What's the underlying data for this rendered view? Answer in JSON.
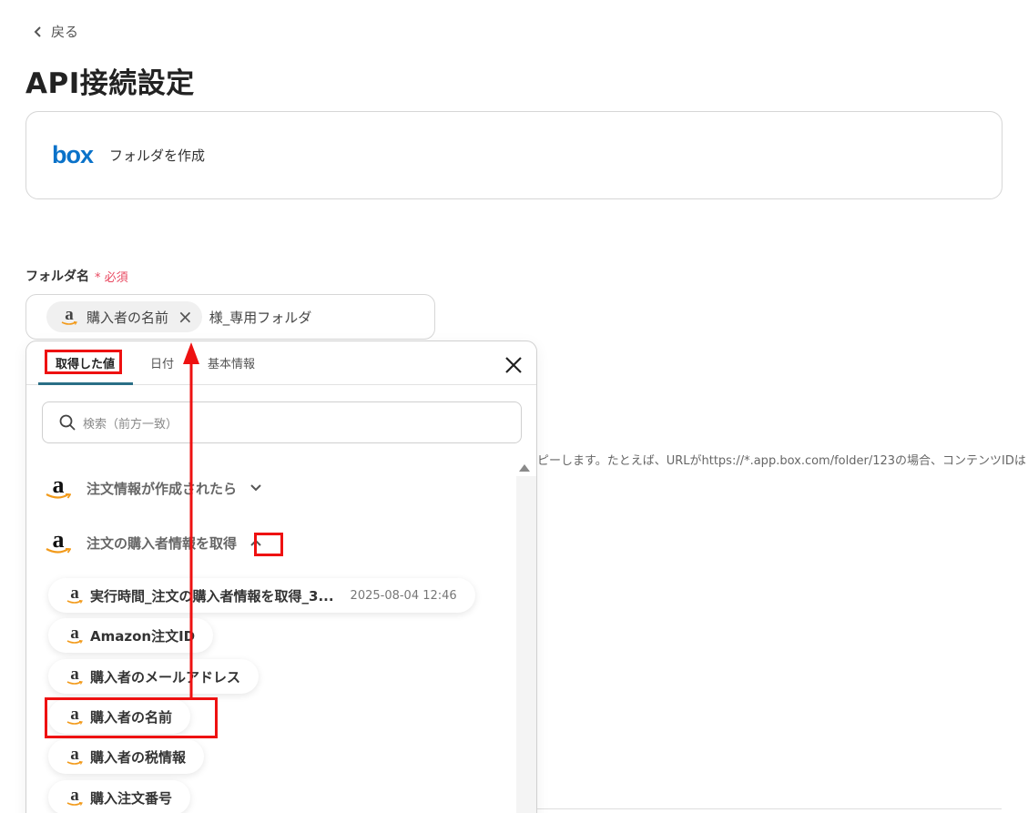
{
  "header": {
    "back_label": "戻る",
    "title": "API接続設定"
  },
  "app_card": {
    "logo_text": "box",
    "action_label": "フォルダを作成"
  },
  "field": {
    "label": "フォルダ名",
    "required_label": "* 必須",
    "token_label": "購入者の名前",
    "suffix_text": "様_専用フォルダ",
    "help_text": "ピーします。たとえば、URLがhttps://*.app.box.com/folder/123の場合、コンテンツIDは"
  },
  "panel": {
    "tabs": [
      {
        "label": "取得した値"
      },
      {
        "label": "日付"
      },
      {
        "label": "基本情報"
      }
    ],
    "search_placeholder": "検索（前方一致）",
    "sections": [
      {
        "label": "注文情報が作成されたら",
        "expanded": false
      },
      {
        "label": "注文の購入者情報を取得",
        "expanded": true
      }
    ],
    "items": [
      {
        "label": "実行時間_注文の購入者情報を取得_3...",
        "date": "2025-08-04 12:46"
      },
      {
        "label": "Amazon注文ID"
      },
      {
        "label": "購入者のメールアドレス"
      },
      {
        "label": "購入者の名前"
      },
      {
        "label": "購入者の税情報"
      },
      {
        "label": "購入注文番号"
      }
    ]
  },
  "icons": {
    "amazon_logo_letter": "a",
    "amazon": "amazon-logo-icon",
    "box": "box-logo-icon"
  },
  "colors": {
    "box_blue": "#0a72c9",
    "required_red": "#e8475f",
    "highlight_red": "#ee1111",
    "tab_accent": "#2a6f86"
  }
}
